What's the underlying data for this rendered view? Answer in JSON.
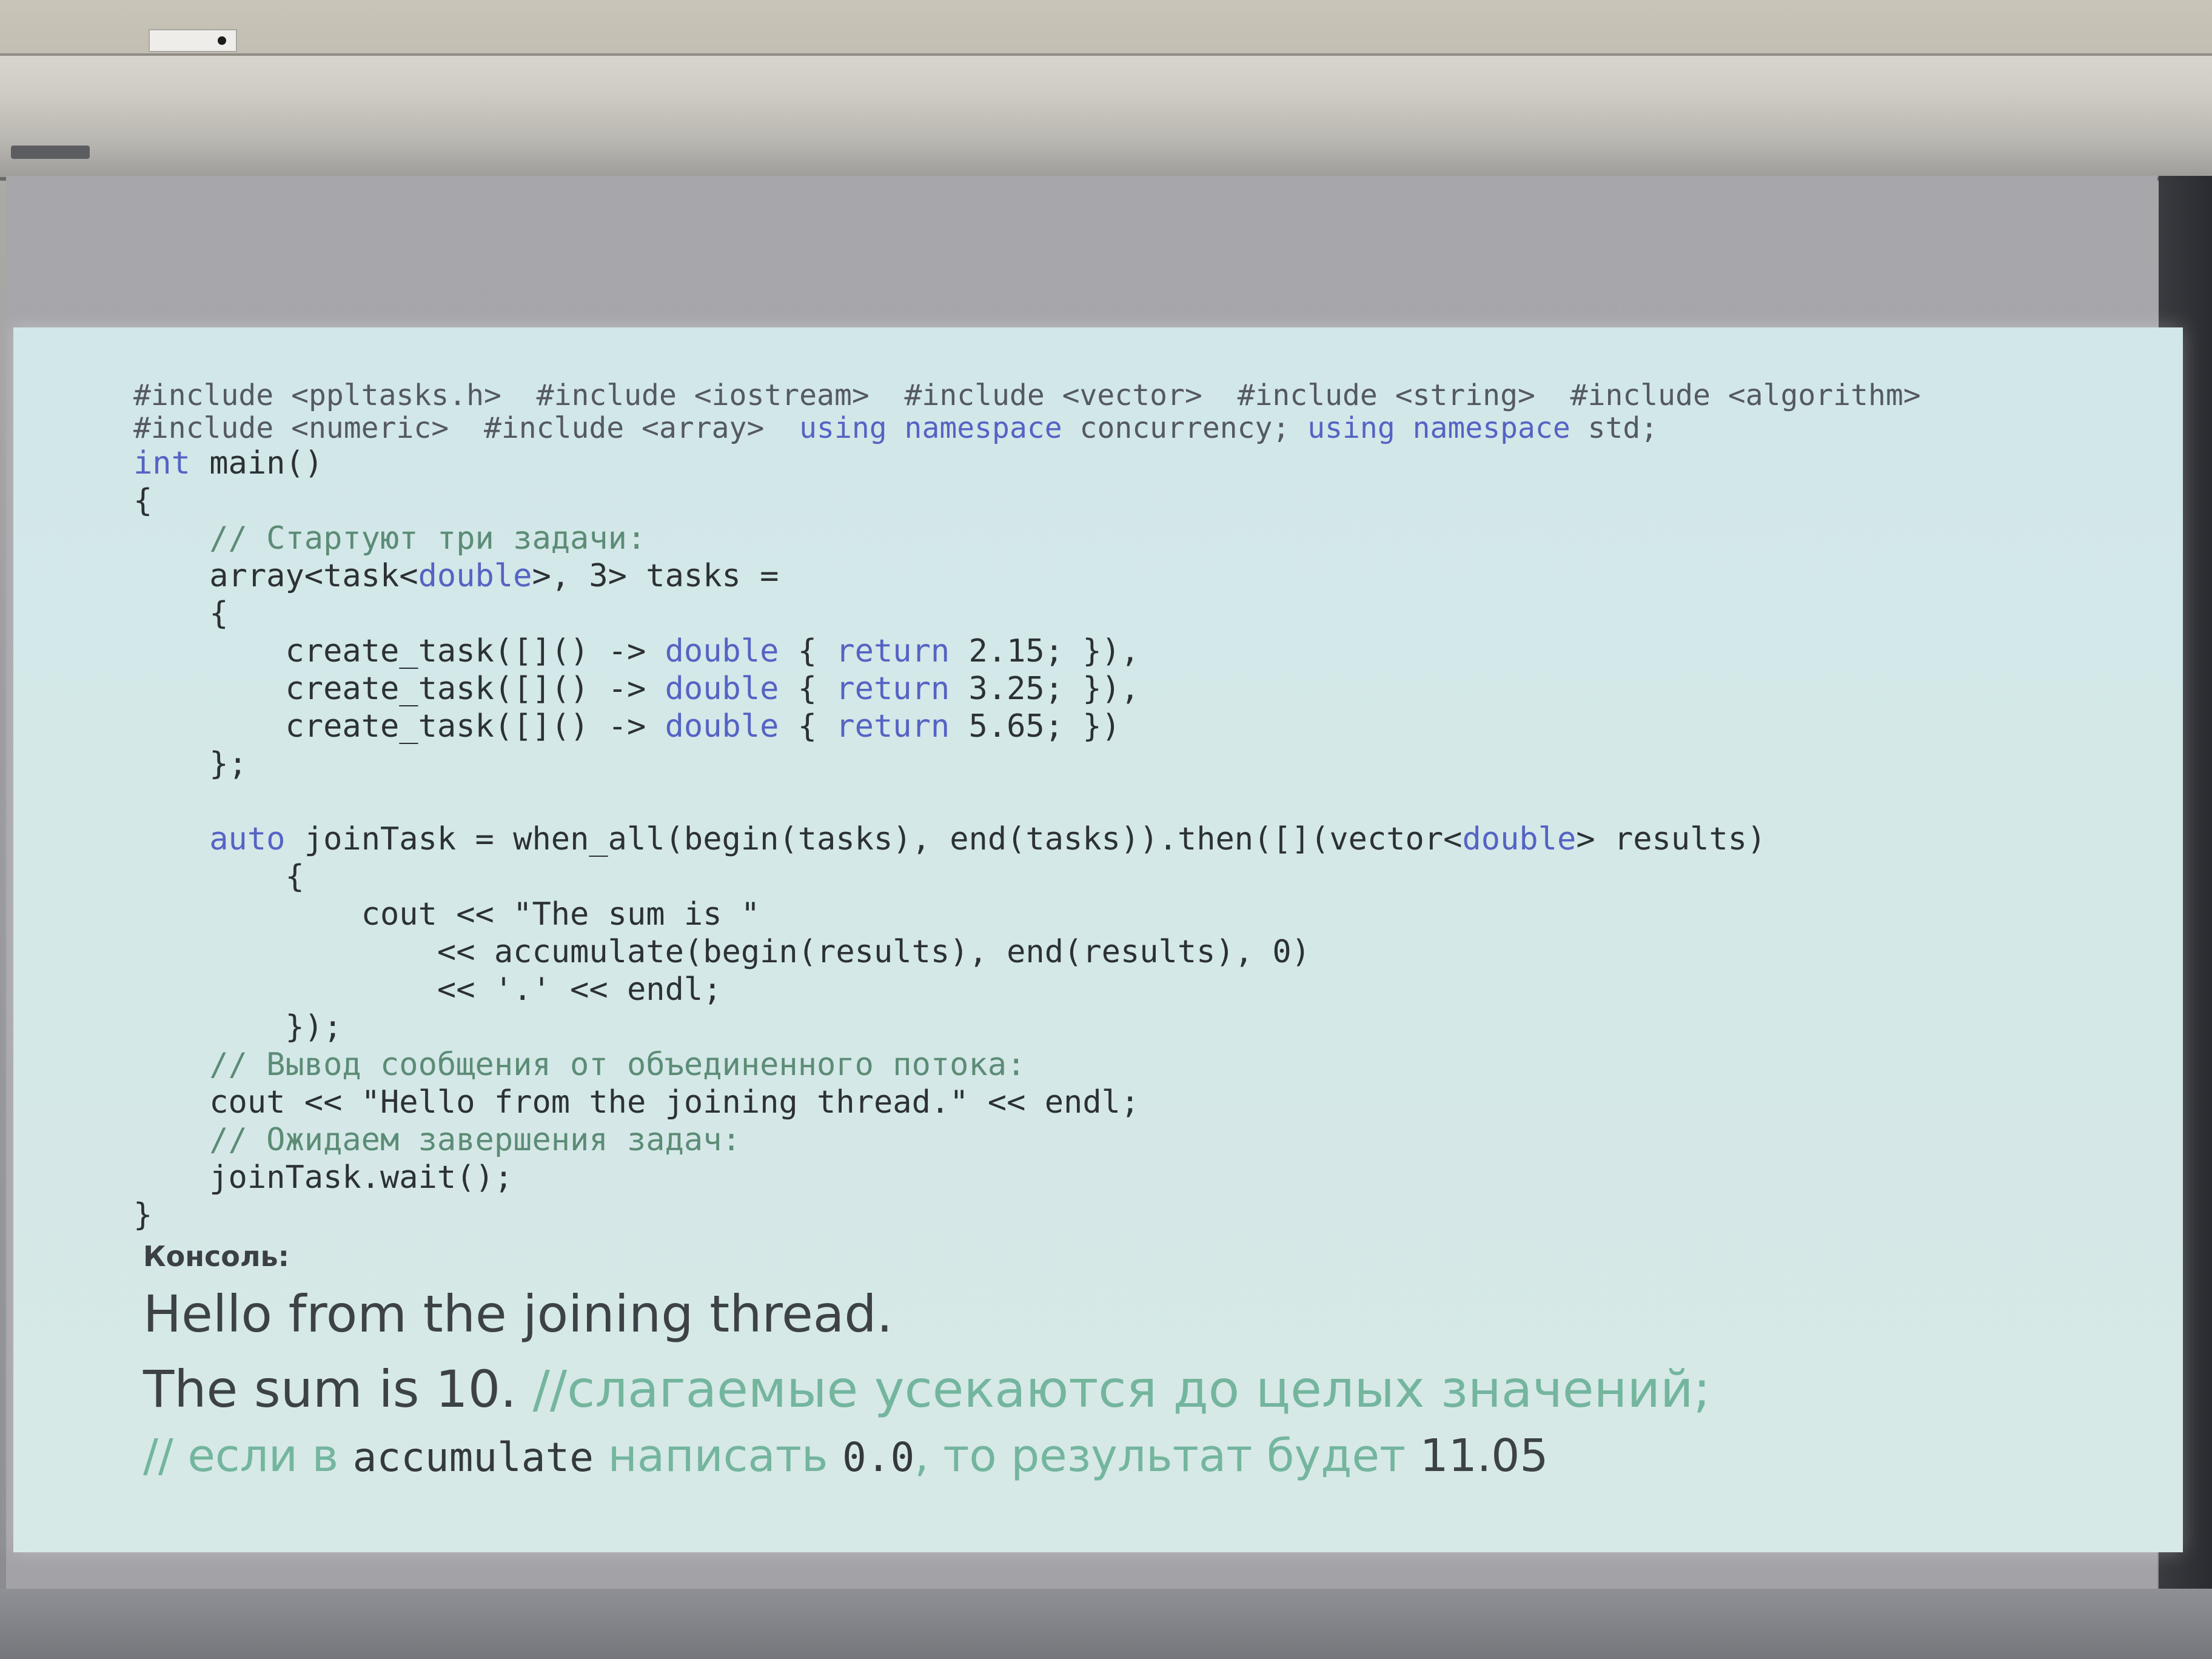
{
  "code_lines": [
    "#include <ppltasks.h>  #include <iostream>  #include <vector>  #include <string>  #include <algorithm>",
    "#include <numeric>  #include <array>  using namespace concurrency; using namespace std;",
    "int main()",
    "{",
    "    // Стартуют три задачи:",
    "    array<task<double>, 3> tasks =",
    "    {",
    "        create_task([]() -> double { return 2.15; }),",
    "        create_task([]() -> double { return 3.25; }),",
    "        create_task([]() -> double { return 5.65; })",
    "    };",
    "",
    "    auto joinTask = when_all(begin(tasks), end(tasks)).then([](vector<double> results)",
    "        {",
    "            cout << \"The sum is \"",
    "                << accumulate(begin(results), end(results), 0)",
    "                << '.' << endl;",
    "        });",
    "    // Вывод сообщения от объединенного потока:",
    "    cout << \"Hello from the joining thread.\" << endl;",
    "    // Ожидаем завершения задач:",
    "    joinTask.wait();",
    "}"
  ],
  "console": {
    "label": "Консоль:",
    "line1": "Hello from the joining thread.",
    "line2_text": "The sum is 10.",
    "line2_comment": "//слагаемые усекаются до целых значений;",
    "line3_part1": "// если в",
    "line3_code1": "accumulate",
    "line3_part2": "написать",
    "line3_code2": "0.0",
    "line3_part3": ", то результат будет",
    "line3_value": "11.05"
  },
  "colors": {
    "slide_background": "#d4e8e8",
    "keyword": "#5563c4",
    "comment": "#5c8c76",
    "console_comment": "#74b59e",
    "code_text": "#2c3136"
  }
}
